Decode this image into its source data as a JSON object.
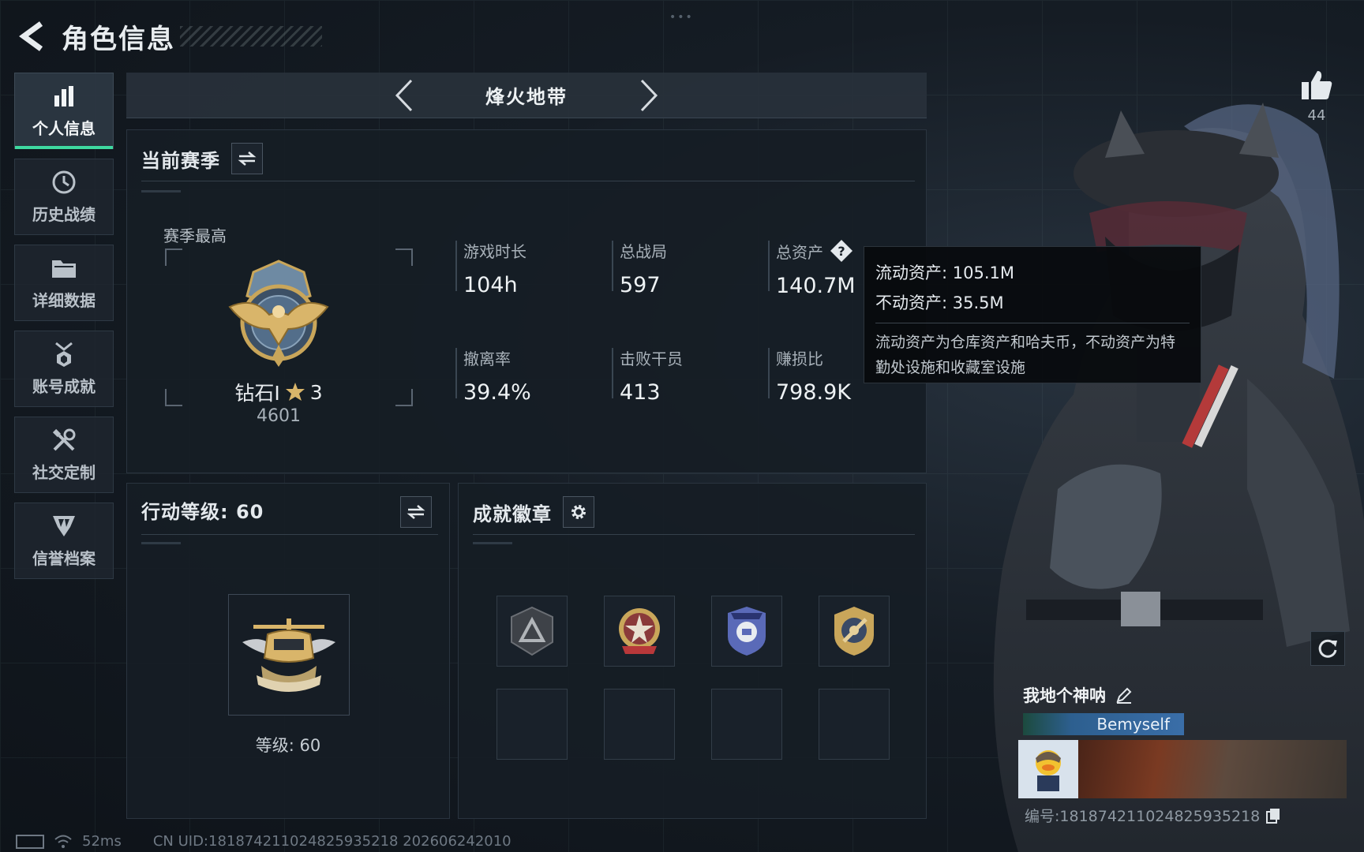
{
  "header": {
    "title": "角色信息",
    "back_icon": "back-arrow-icon"
  },
  "sidebar": {
    "items": [
      {
        "label": "个人信息",
        "icon": "bar-chart-icon",
        "active": true
      },
      {
        "label": "历史战绩",
        "icon": "history-clock-icon",
        "active": false
      },
      {
        "label": "详细数据",
        "icon": "folder-icon",
        "active": false
      },
      {
        "label": "账号成就",
        "icon": "medal-icon",
        "active": false
      },
      {
        "label": "社交定制",
        "icon": "tools-icon",
        "active": false
      },
      {
        "label": "信誉档案",
        "icon": "shield-emblem-icon",
        "active": false
      }
    ],
    "accent_color": "#3ed9a0"
  },
  "mode_switch": {
    "title": "烽火地带"
  },
  "season": {
    "title": "当前赛季",
    "best_label": "赛季最高",
    "rank_name": "钻石I",
    "rank_stars": "3",
    "rank_score": "4601",
    "stats": [
      {
        "label": "游戏时长",
        "value": "104h"
      },
      {
        "label": "总战局",
        "value": "597"
      },
      {
        "label": "总资产",
        "value": "140.7M"
      },
      {
        "label": "撤离率",
        "value": "39.4%"
      },
      {
        "label": "击败干员",
        "value": "413"
      },
      {
        "label": "赚损比",
        "value": "798.9K"
      }
    ]
  },
  "tooltip": {
    "liquid": "流动资产: 105.1M",
    "fixed": "不动资产: 35.5M",
    "description": "流动资产为仓库资产和哈夫币，不动资产为特勤处设施和收藏室设施"
  },
  "level": {
    "title": "行动等级: 60",
    "level_text": "等级: 60"
  },
  "badges": {
    "title": "成就徽章"
  },
  "like": {
    "count": "44"
  },
  "profile": {
    "nickname": "我地个神呐",
    "name_tag": "Bemyself",
    "uid_text": "编号:181874211024825935218"
  },
  "status_bar": {
    "ping": "52ms",
    "uid": "CN UID:181874211024825935218 202606242010"
  }
}
